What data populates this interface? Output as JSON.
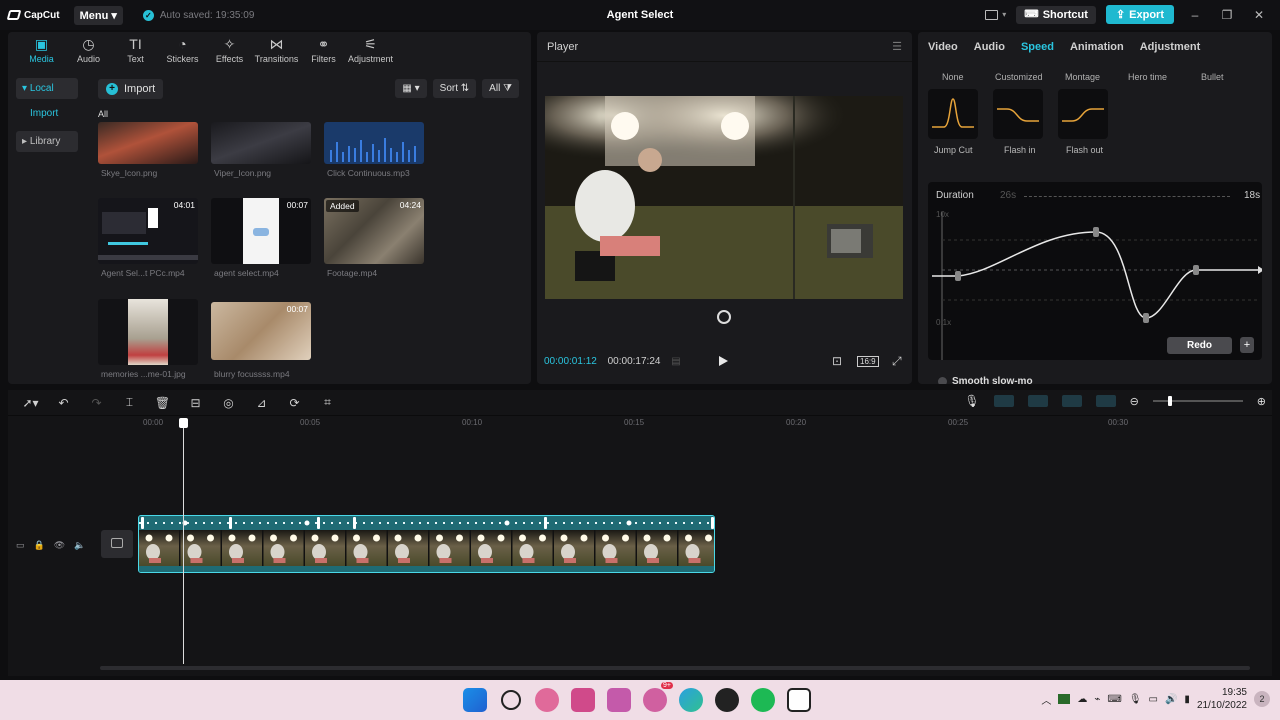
{
  "app": {
    "brand": "CapCut",
    "menu_label": "Menu",
    "autosave_text": "Auto saved: 19:35:09",
    "project_title": "Agent Select",
    "shortcut_label": "Shortcut",
    "export_label": "Export"
  },
  "media_toolbar": [
    {
      "label": "Media",
      "icon": "media-icon",
      "active": true
    },
    {
      "label": "Audio",
      "icon": "audio-icon"
    },
    {
      "label": "Text",
      "icon": "text-icon"
    },
    {
      "label": "Stickers",
      "icon": "stickers-icon"
    },
    {
      "label": "Effects",
      "icon": "effects-icon"
    },
    {
      "label": "Transitions",
      "icon": "transitions-icon"
    },
    {
      "label": "Filters",
      "icon": "filters-icon"
    },
    {
      "label": "Adjustment",
      "icon": "adjustment-icon"
    }
  ],
  "media_side": {
    "local": "Local",
    "import": "Import",
    "library": "Library"
  },
  "media_panel": {
    "import_label": "Import",
    "sort_label": "Sort",
    "all_filter": "All",
    "all_heading": "All",
    "items": [
      {
        "name": "Skye_Icon.png",
        "duration": ""
      },
      {
        "name": "Viper_Icon.png",
        "duration": ""
      },
      {
        "name": "Click Continuous.mp3",
        "duration": ""
      },
      {
        "name": "Agent Sel...t PCc.mp4",
        "duration": "04:01"
      },
      {
        "name": "agent select.mp4",
        "duration": "00:07"
      },
      {
        "name": "Footage.mp4",
        "duration": "04:24",
        "badge": "Added"
      },
      {
        "name": "memories ...me-01.jpg",
        "duration": ""
      },
      {
        "name": "blurry focussss.mp4",
        "duration": "00:07"
      }
    ]
  },
  "player": {
    "title": "Player",
    "current_time": "00:00:01:12",
    "total_time": "00:00:17:24",
    "ratio": "16:9"
  },
  "properties": {
    "tabs": [
      "Video",
      "Audio",
      "Speed",
      "Animation",
      "Adjustment"
    ],
    "active_tab": "Speed",
    "speed_presets_row1": [
      "None",
      "Customized",
      "Montage",
      "Hero time",
      "Bullet"
    ],
    "speed_presets_row2": [
      "Jump Cut",
      "Flash in",
      "Flash out"
    ],
    "duration_label": "Duration",
    "duration_from": "26s",
    "duration_to": "18s",
    "curve_top_label": "10x",
    "curve_bottom_label": "0.1x",
    "redo_label": "Redo",
    "plus_label": "+",
    "smooth_label": "Smooth slow-mo"
  },
  "timeline": {
    "ruler": [
      "00:00",
      "00:05",
      "00:10",
      "00:15",
      "00:20",
      "00:25",
      "00:30"
    ]
  },
  "taskbar": {
    "time": "19:35",
    "date": "21/10/2022",
    "notifications": "2",
    "badge": "9+"
  },
  "colors": {
    "accent": "#27c0d6",
    "panel": "#1a1a1d",
    "clip_border": "#4ad9e8"
  }
}
